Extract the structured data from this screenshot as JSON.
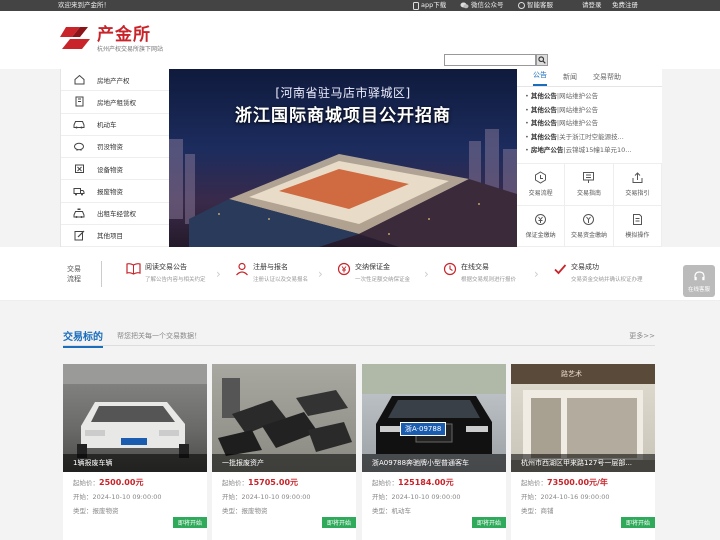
{
  "topbar": {
    "welcome": "欢迎来到产金所！",
    "app_download": "app下载",
    "wechat": "微信公众号",
    "service": "智能客服",
    "login": "请登录",
    "register": "免费注册"
  },
  "header": {
    "brand": "产金所",
    "tagline": "杭州产权交易所旗下网站",
    "search_placeholder": ""
  },
  "categories": [
    {
      "label": "房地产产权",
      "icon": "house-icon"
    },
    {
      "label": "房地产租赁权",
      "icon": "building-icon"
    },
    {
      "label": "机动车",
      "icon": "car-icon"
    },
    {
      "label": "罚没物资",
      "icon": "piggy-bank-icon"
    },
    {
      "label": "设备物资",
      "icon": "box-icon"
    },
    {
      "label": "报废物资",
      "icon": "truck-icon"
    },
    {
      "label": "出租车经营权",
      "icon": "taxi-icon"
    },
    {
      "label": "其他项目",
      "icon": "edit-icon"
    }
  ],
  "banner": {
    "line1": "[河南省驻马店市驿城区]",
    "line2": "浙江国际商城项目公开招商"
  },
  "notice_panel": {
    "tabs": [
      {
        "label": "公告",
        "active": true
      },
      {
        "label": "新闻",
        "active": false
      },
      {
        "label": "交易帮助",
        "active": false
      }
    ],
    "items": [
      {
        "type": "其他公告",
        "text": "|网站维护公告"
      },
      {
        "type": "其他公告",
        "text": "|网站维护公告"
      },
      {
        "type": "其他公告",
        "text": "|网站维护公告"
      },
      {
        "type": "其他公告",
        "text": "|关于浙江时空能源技..."
      },
      {
        "type": "房地产公告",
        "text": "|云锦城15幢1单元10..."
      }
    ],
    "shortcuts": [
      {
        "label": "交易流程",
        "icon": "flow-icon"
      },
      {
        "label": "交易指南",
        "icon": "guide-icon"
      },
      {
        "label": "交易指引",
        "icon": "upload-icon"
      },
      {
        "label": "保证金缴纳",
        "icon": "deposit-icon"
      },
      {
        "label": "交易资金缴纳",
        "icon": "payment-icon"
      },
      {
        "label": "模拟操作",
        "icon": "document-icon"
      }
    ]
  },
  "flow": {
    "label_line1": "交易",
    "label_line2": "流程",
    "steps": [
      {
        "title": "阅读交易公告",
        "sub": "了解公告内容与相关约定",
        "icon": "book-icon"
      },
      {
        "title": "注册与报名",
        "sub": "注册认证以及交易报名",
        "icon": "user-icon"
      },
      {
        "title": "交纳保证金",
        "sub": "一次性足额交纳保证金",
        "icon": "wallet-icon"
      },
      {
        "title": "在线交易",
        "sub": "根据交易规则进行报价",
        "icon": "clock-icon"
      },
      {
        "title": "交易成功",
        "sub": "交易资金交纳并确认权证办理",
        "icon": "check-icon"
      }
    ],
    "side_button": "在线客服"
  },
  "section": {
    "title": "交易标的",
    "subtitle": "帮您把关每一个交易数据！",
    "more": "更多>>"
  },
  "cards": [
    {
      "title": "1辆报废车辆",
      "price_label": "起始价：",
      "price": "2500.00元",
      "start_label": "开始：",
      "start": "2024-10-10 09:00:00",
      "type_label": "类型：",
      "type": "报废物资",
      "badge": "即将开始"
    },
    {
      "title": "一批报废资产",
      "price_label": "起始价：",
      "price": "15705.00元",
      "start_label": "开始：",
      "start": "2024-10-10 09:00:00",
      "type_label": "类型：",
      "type": "报废物资",
      "badge": "即将开始"
    },
    {
      "title": "浙A09788奔驰牌小型普通客车",
      "plate": "浙A·09788",
      "price_label": "起始价：",
      "price": "125184.00元",
      "start_label": "开始：",
      "start": "2024-10-10 09:00:00",
      "type_label": "类型：",
      "type": "机动车",
      "badge": "即将开始"
    },
    {
      "title": "杭州市西湖区甲来路127号一层部...",
      "shop_sign": "路艺术",
      "price_label": "起始价：",
      "price": "73500.00元/年",
      "start_label": "开始：",
      "start": "2024-10-16 09:00:00",
      "type_label": "类型：",
      "type": "商铺",
      "badge": "即将开始"
    }
  ]
}
